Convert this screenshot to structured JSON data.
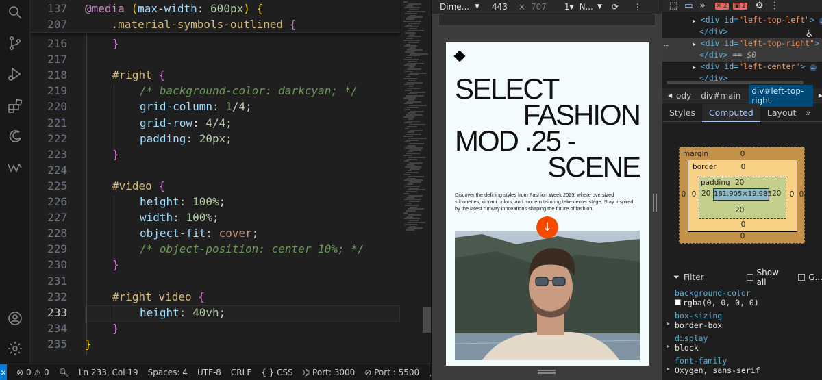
{
  "editor": {
    "sticky": [
      {
        "num": "137",
        "text": "@media (max-width: 600px) {"
      },
      {
        "num": "207",
        "text": ".material-symbols-outlined {"
      }
    ],
    "lines": [
      {
        "num": "216",
        "text": "}"
      },
      {
        "num": "217",
        "text": ""
      },
      {
        "num": "218",
        "text": "#right {"
      },
      {
        "num": "219",
        "text": "/* background-color: darkcyan; */"
      },
      {
        "num": "220",
        "text": "grid-column: 1/4;"
      },
      {
        "num": "221",
        "text": "grid-row: 4/4;"
      },
      {
        "num": "222",
        "text": "padding: 20px;"
      },
      {
        "num": "223",
        "text": "}"
      },
      {
        "num": "224",
        "text": ""
      },
      {
        "num": "225",
        "text": "#video {"
      },
      {
        "num": "226",
        "text": "height: 100%;"
      },
      {
        "num": "227",
        "text": "width: 100%;"
      },
      {
        "num": "228",
        "text": "object-fit: cover;"
      },
      {
        "num": "229",
        "text": "/* object-position: center 10%; */"
      },
      {
        "num": "230",
        "text": "}"
      },
      {
        "num": "231",
        "text": ""
      },
      {
        "num": "232",
        "text": "#right video {"
      },
      {
        "num": "233",
        "text": "height: 40vh;"
      },
      {
        "num": "234",
        "text": "}"
      },
      {
        "num": "235",
        "text": "}"
      }
    ]
  },
  "status": {
    "errors": "0",
    "warnings": "0",
    "position": "Ln 233, Col 19",
    "spaces": "Spaces: 4",
    "encoding": "UTF-8",
    "eol": "CRLF",
    "language": "{ } CSS",
    "port": "Port: 3000",
    "port2": "Port : 5500"
  },
  "browser": {
    "device": "Dime...",
    "width": "443",
    "times": "×",
    "height": "707",
    "dpr": "1▾",
    "throttle": "N...",
    "headline": [
      "SELECT",
      "FASHION",
      "MOD .25 -",
      "SCENE"
    ],
    "description": "Discover the defining styles from Fashion Week 2025, where oversized silhouettes, vibrant colors, and modern tailoring take center stage. Stay inspired by the latest runway innovations shaping the future of fashion.",
    "arrow": "↓"
  },
  "devtools": {
    "dom": [
      {
        "tag": "div",
        "id": "left-top-left",
        "suffix": ">",
        "dots": true
      },
      {
        "close": "</div>"
      },
      {
        "tag": "div",
        "id": "left-top-right",
        "suffix": ">",
        "dots": true
      },
      {
        "close": "</div> == $0"
      },
      {
        "tag": "div",
        "id": "left-center",
        "suffix": ">",
        "dots": true
      },
      {
        "close": "</div>"
      }
    ],
    "crumbs": [
      "ody",
      "div#main",
      "div#left-top-right"
    ],
    "tabs": [
      "Styles",
      "Computed",
      "Layout"
    ],
    "active_tab": "Computed",
    "boxmodel": {
      "margin_label": "margin",
      "margin": "0",
      "border_label": "border",
      "border": "0",
      "padding_label": "padding",
      "padding": "20",
      "content": "181.905×19.985"
    },
    "filter_placeholder": "Filter",
    "show_all": "Show all",
    "group": "G...",
    "computed": [
      {
        "name": "background-color",
        "value": "rgba(0, 0, 0, 0)",
        "swatch": true
      },
      {
        "name": "box-sizing",
        "value": "border-box"
      },
      {
        "name": "display",
        "value": "block"
      },
      {
        "name": "font-family",
        "value": "Oxygen, sans-serif"
      }
    ]
  }
}
